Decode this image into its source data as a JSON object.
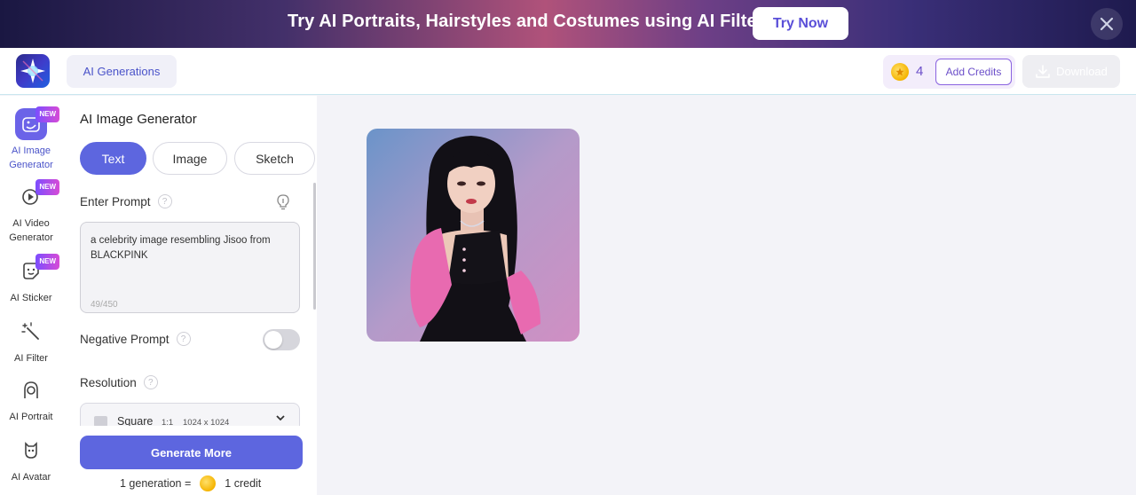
{
  "banner": {
    "text": "Try AI Portraits, Hairstyles and Costumes using AI Filters",
    "cta": "Try Now"
  },
  "header": {
    "tab_label": "AI Generations",
    "credits": "4",
    "add_credits": "Add Credits",
    "download": "Download"
  },
  "rail": {
    "items": [
      {
        "label": "AI Image Generator",
        "badge": "NEW",
        "icon": "image-generator-icon"
      },
      {
        "label": "AI Video Generator",
        "badge": "NEW",
        "icon": "video-generator-icon"
      },
      {
        "label": "AI Sticker",
        "badge": "NEW",
        "icon": "sticker-icon"
      },
      {
        "label": "AI Filter",
        "icon": "magic-wand-icon"
      },
      {
        "label": "AI Portrait",
        "icon": "portrait-icon"
      },
      {
        "label": "AI Avatar",
        "icon": "avatar-icon"
      }
    ]
  },
  "panel": {
    "title": "AI Image Generator",
    "modes": [
      "Text",
      "Image",
      "Sketch"
    ],
    "active_mode": "Text",
    "prompt_label": "Enter Prompt",
    "prompt_text": "a celebrity image resembling Jisoo from BLACKPINK",
    "prompt_count": "49/450",
    "negative_label": "Negative Prompt",
    "negative_enabled": false,
    "resolution_label": "Resolution",
    "resolution": {
      "name": "Square",
      "ratio": "1:1",
      "size": "1024 x 1024"
    },
    "generate_button": "Generate More",
    "cost_left": "1 generation =",
    "cost_right": "1 credit"
  },
  "colors": {
    "accent": "#5d66df",
    "credit_purple": "#6b4ec9",
    "coin": "#f5b400"
  }
}
